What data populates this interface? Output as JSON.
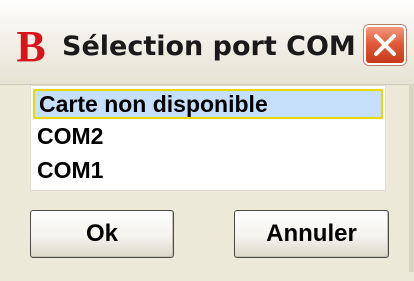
{
  "window": {
    "title": "Sélection port COM",
    "app_icon_letter": "B",
    "app_icon_color": "#d8141a",
    "close_icon": "close-icon"
  },
  "port_list": {
    "items": [
      {
        "label": "Carte non disponible",
        "selected": true
      },
      {
        "label": "COM2",
        "selected": false
      },
      {
        "label": "COM1",
        "selected": false
      }
    ],
    "selection_color": "#c6dffb",
    "focus_border_color": "#e6d800"
  },
  "buttons": {
    "ok_label": "Ok",
    "cancel_label": "Annuler"
  }
}
